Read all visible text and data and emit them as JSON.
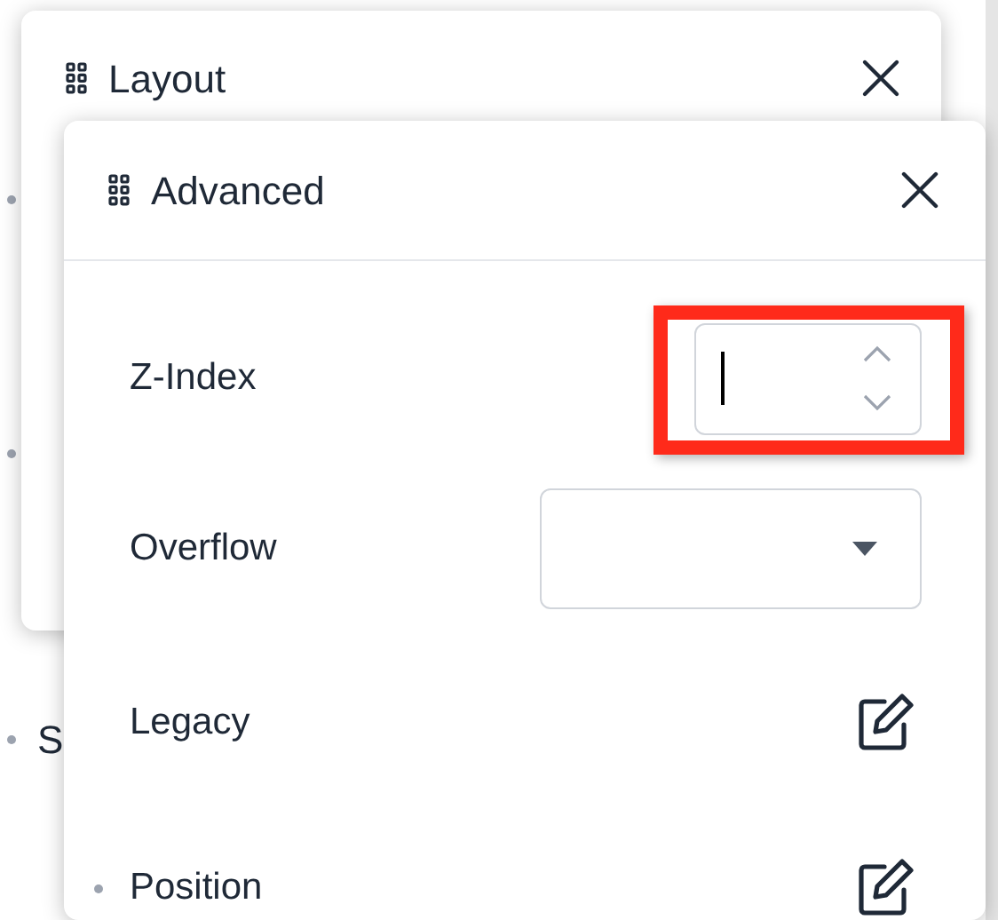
{
  "background_list": {
    "items": [
      {
        "label": "S"
      }
    ]
  },
  "layout_panel": {
    "title": "Layout"
  },
  "advanced_panel": {
    "title": "Advanced",
    "rows": [
      {
        "kind": "number",
        "label": "Z-Index",
        "highlighted": true
      },
      {
        "kind": "select",
        "label": "Overflow"
      },
      {
        "kind": "edit",
        "label": "Legacy"
      },
      {
        "kind": "edit",
        "label": "Position"
      }
    ]
  }
}
